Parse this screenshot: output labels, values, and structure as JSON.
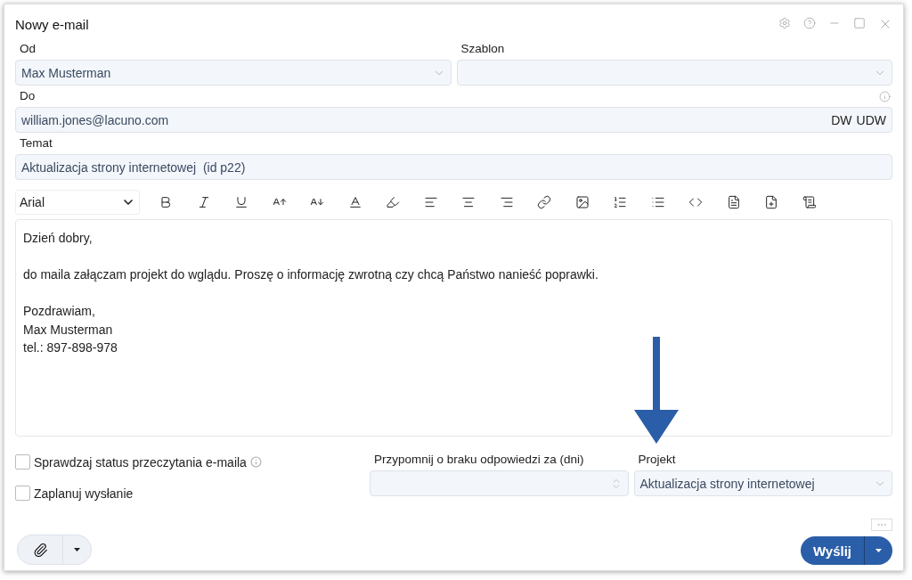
{
  "window": {
    "title": "Nowy e-mail"
  },
  "from": {
    "label": "Od",
    "value": "Max Musterman"
  },
  "template": {
    "label": "Szablon"
  },
  "to": {
    "label": "Do",
    "value": "william.jones@lacuno.com",
    "cc": "DW",
    "bcc": "UDW"
  },
  "subject": {
    "label": "Temat",
    "value": "Aktualizacja strony internetowej  (id p22)"
  },
  "editor": {
    "font": "Arial",
    "paragraphs": [
      [
        "Dzień dobry,"
      ],
      [
        "do maila załączam projekt do wglądu. Proszę o informację zwrotną czy chcą Państwo nanieść poprawki."
      ],
      [
        "Pozdrawiam,",
        "Max Musterman",
        "tel.: 897-898-978"
      ]
    ]
  },
  "options": [
    {
      "label": "Sprawdzaj status przeczytania e-maila",
      "checked": false,
      "info": true
    },
    {
      "label": "Zaplanuj wysłanie",
      "checked": false,
      "info": false
    }
  ],
  "reminder": {
    "label": "Przypomnij o braku odpowiedzi za (dni)"
  },
  "project": {
    "label": "Projekt",
    "value": "Aktualizacja strony internetowej"
  },
  "send_button": "Wyślij"
}
